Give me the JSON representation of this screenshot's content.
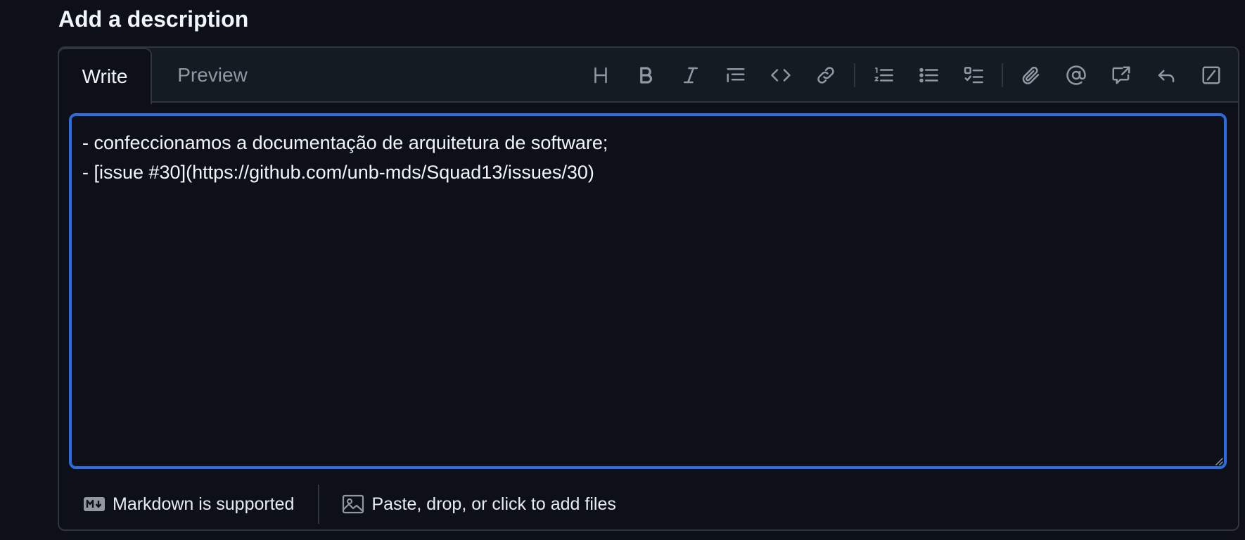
{
  "title": "Add a description",
  "tabs": {
    "write": "Write",
    "preview": "Preview"
  },
  "toolbar": {
    "items": [
      "heading-icon",
      "bold-icon",
      "italic-icon",
      "quote-icon",
      "code-icon",
      "link-icon",
      "ordered-list-icon",
      "unordered-list-icon",
      "task-list-icon",
      "attach-icon",
      "mention-icon",
      "reference-icon",
      "reply-icon",
      "slash-commands-icon"
    ]
  },
  "textarea": {
    "line1": "- confeccionamos a documentação de arquitetura de software;",
    "line2": "- [issue #30](https://github.com/unb-mds/Squad13/issues/30)"
  },
  "footer": {
    "markdown_label": "Markdown is supported",
    "attach_label": "Paste, drop, or click to add files"
  },
  "colors": {
    "background": "#0d1117",
    "border": "#30363d",
    "focus": "#2f6ee0",
    "muted": "#9198a1"
  }
}
